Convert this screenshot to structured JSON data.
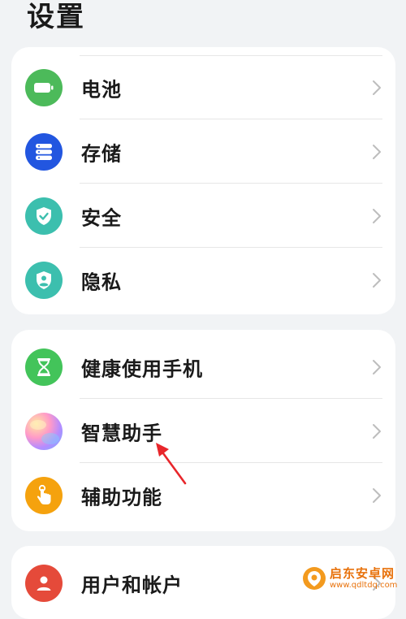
{
  "header": {
    "title": "设置"
  },
  "groups": [
    {
      "items": [
        {
          "label": "电池",
          "icon": "battery-icon",
          "color": "#4cba5a"
        },
        {
          "label": "存储",
          "icon": "storage-icon",
          "color": "#2256e0"
        },
        {
          "label": "安全",
          "icon": "shield-check-icon",
          "color": "#3cbfae"
        },
        {
          "label": "隐私",
          "icon": "privacy-shield-icon",
          "color": "#3cbfae"
        }
      ]
    },
    {
      "items": [
        {
          "label": "健康使用手机",
          "icon": "hourglass-icon",
          "color": "#43c45a"
        },
        {
          "label": "智慧助手",
          "icon": "smart-assistant-icon",
          "color": "gradient"
        },
        {
          "label": "辅助功能",
          "icon": "hand-touch-icon",
          "color": "#f5a20e"
        }
      ]
    },
    {
      "items": [
        {
          "label": "用户和帐户",
          "icon": "user-icon",
          "color": "#e54a3a"
        }
      ]
    }
  ],
  "watermark": {
    "title": "启东安卓网",
    "url": "www.qdltdq.com"
  }
}
